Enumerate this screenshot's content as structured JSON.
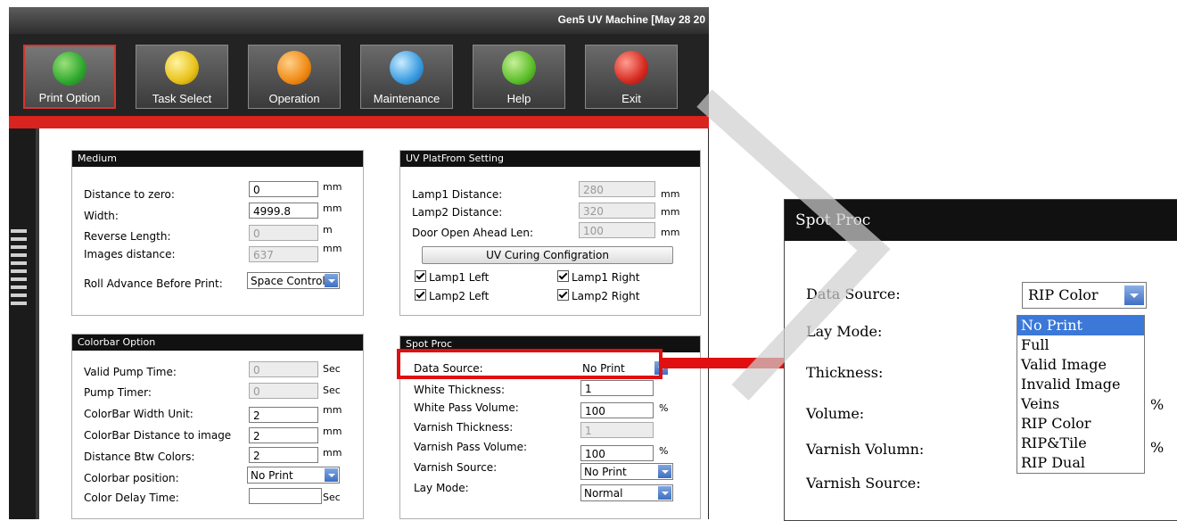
{
  "window": {
    "title": "Gen5 UV Machine [May 28 20"
  },
  "toolbar": {
    "buttons": [
      {
        "label": "Print Option",
        "icon": "print-option-icon",
        "color": "#2fa82f"
      },
      {
        "label": "Task Select",
        "icon": "task-select-icon",
        "color": "#e8c21a"
      },
      {
        "label": "Operation",
        "icon": "operation-icon",
        "color": "#f08a14"
      },
      {
        "label": "Maintenance",
        "icon": "maintenance-icon",
        "color": "#3a9be0"
      },
      {
        "label": "Help",
        "icon": "help-icon",
        "color": "#5cbf2a"
      },
      {
        "label": "Exit",
        "icon": "exit-icon",
        "color": "#d62a20"
      }
    ]
  },
  "medium": {
    "title": "Medium",
    "distance_to_zero": {
      "label": "Distance to zero:",
      "value": "0",
      "unit": "mm"
    },
    "width": {
      "label": "Width:",
      "value": "4999.8",
      "unit": "mm"
    },
    "reverse_length": {
      "label": "Reverse Length:",
      "value": "0",
      "unit": "m"
    },
    "images_distance": {
      "label": "Images distance:",
      "value": "637",
      "unit": "mm"
    },
    "roll_advance": {
      "label": "Roll Advance Before Print:",
      "value": "Space Control"
    }
  },
  "uv_platform": {
    "title": "UV PlatFrom Setting",
    "lamp1_distance": {
      "label": "Lamp1 Distance:",
      "value": "280",
      "unit": "mm"
    },
    "lamp2_distance": {
      "label": "Lamp2 Distance:",
      "value": "320",
      "unit": "mm"
    },
    "door_open": {
      "label": "Door Open Ahead Len:",
      "value": "100",
      "unit": "mm"
    },
    "curing_button": "UV Curing Configration",
    "checks": [
      "Lamp1 Left",
      "Lamp1 Right",
      "Lamp2 Left",
      "Lamp2 Right"
    ]
  },
  "colorbar": {
    "title": "Colorbar Option",
    "valid_pump_time": {
      "label": "Valid Pump Time:",
      "value": "0",
      "unit": "Sec"
    },
    "pump_timer": {
      "label": "Pump Timer:",
      "value": "0",
      "unit": "Sec"
    },
    "width_unit": {
      "label": "ColorBar Width Unit:",
      "value": "2",
      "unit": "mm"
    },
    "distance_to_image": {
      "label": "ColorBar Distance to image",
      "value": "2",
      "unit": "mm"
    },
    "distance_btw": {
      "label": "Distance Btw Colors:",
      "value": "2",
      "unit": "mm"
    },
    "position": {
      "label": "Colorbar position:",
      "value": "No Print"
    },
    "delay": {
      "label": "Color Delay Time:",
      "value": "",
      "unit": "Sec"
    }
  },
  "spot_proc": {
    "title": "Spot Proc",
    "data_source": {
      "label": "Data Source:",
      "value": "No Print"
    },
    "white_thickness": {
      "label": "White Thickness:",
      "value": "1"
    },
    "white_pass_volume": {
      "label": "White Pass Volume:",
      "value": "100",
      "unit": "%"
    },
    "varnish_thickness": {
      "label": "Varnish Thickness:",
      "value": "1"
    },
    "varnish_pass_volume": {
      "label": "Varnish Pass Volume:",
      "value": "100",
      "unit": "%"
    },
    "varnish_source": {
      "label": "Varnish Source:",
      "value": "No Print"
    },
    "lay_mode": {
      "label": "Lay Mode:",
      "value": "Normal"
    }
  },
  "zoom": {
    "title": "Spot Proc",
    "data_source_label": "Data Source:",
    "data_source_value": "RIP Color",
    "lay_mode_label": "Lay Mode:",
    "thickness_label": "Thickness:",
    "volume_label": "Volume:",
    "varnish_volumn_label": "Varnish Volumn:",
    "varnish_source_label": "Varnish Source:",
    "percent1": "%",
    "percent2": "%",
    "options": [
      "No Print",
      "Full",
      "Valid Image",
      "Invalid Image",
      "Veins",
      "RIP Color",
      "RIP&Tile",
      "RIP Dual"
    ],
    "highlighted_option": "No Print"
  },
  "colors": {
    "accent_red": "#d8231f",
    "highlight_blue": "#3b78d8"
  }
}
